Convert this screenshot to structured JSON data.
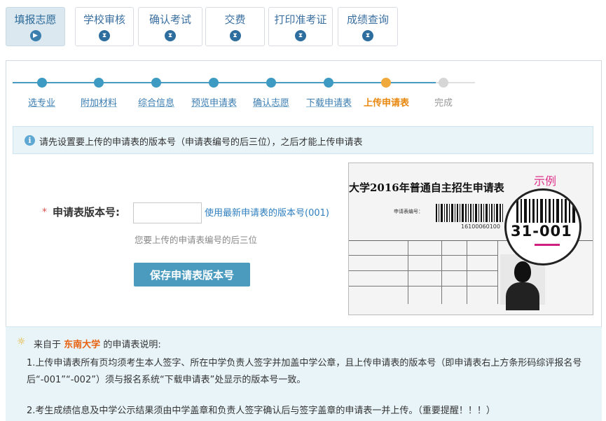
{
  "tabs": [
    {
      "label": "填报志愿",
      "icon": "play-icon",
      "active": true
    },
    {
      "label": "学校审核",
      "icon": "hourglass-icon",
      "active": false
    },
    {
      "label": "确认考试",
      "icon": "hourglass-icon",
      "active": false
    },
    {
      "label": "交费",
      "icon": "hourglass-icon",
      "active": false
    },
    {
      "label": "打印准考证",
      "icon": "hourglass-icon",
      "active": false
    },
    {
      "label": "成绩查询",
      "icon": "hourglass-icon",
      "active": false
    }
  ],
  "steps": [
    {
      "label": "选专业",
      "state": "done"
    },
    {
      "label": "附加材料",
      "state": "done"
    },
    {
      "label": "综合信息",
      "state": "done"
    },
    {
      "label": "预览申请表",
      "state": "done"
    },
    {
      "label": "确认志愿",
      "state": "done"
    },
    {
      "label": "下载申请表",
      "state": "done"
    },
    {
      "label": "上传申请表",
      "state": "current"
    },
    {
      "label": "完成",
      "state": "pending"
    }
  ],
  "notice": {
    "text": "请先设置要上传的申请表的版本号（申请表编号的后三位），之后才能上传申请表"
  },
  "form": {
    "required_mark": "*",
    "label": "申请表版本号:",
    "input_value": "",
    "use_latest_link": "使用最新申请表的版本号(001)",
    "hint": "您要上传的申请表编号的后三位",
    "save_button": "保存申请表版本号"
  },
  "sample": {
    "title": "大学2016年普通自主招生申请表",
    "example_label": "示例",
    "code_label": "申请表编号：",
    "barcode_number": "16100060100",
    "magnified_code": "31-001"
  },
  "description": {
    "prefix": "来自于",
    "university": "东南大学",
    "suffix": "的申请表说明:",
    "lines": [
      "1.上传申请表所有页均须考生本人签字、所在中学负责人签字并加盖中学公章，且上传申请表的版本号（即申请表右上方条形码综评报名号",
      "后“-001”“-002”）须与报名系统“下载申请表”处显示的版本号一致。",
      "2.考生成绩信息及中学公示结果须由中学盖章和负责人签字确认后与签字盖章的申请表一并上传。（重要提醒！！！）"
    ]
  },
  "colors": {
    "accent": "#4b9bbf",
    "current_step": "#f0a93b",
    "university": "#e8610e",
    "example": "#e0308a"
  }
}
